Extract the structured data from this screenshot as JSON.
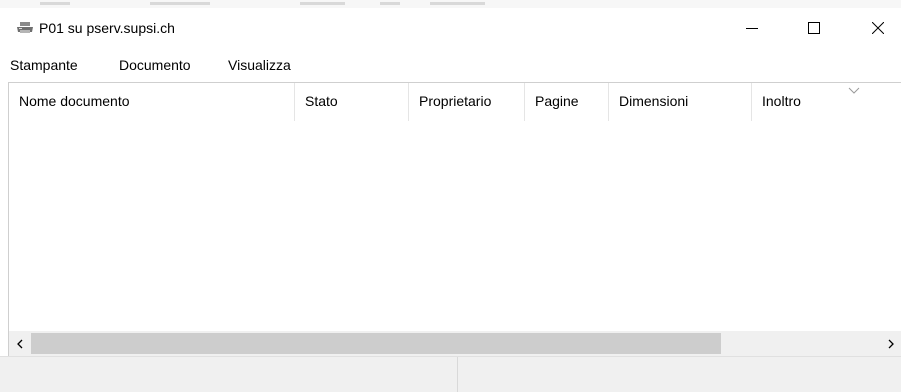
{
  "window": {
    "title": "P01 su pserv.supsi.ch",
    "app_icon": "printer-icon",
    "controls": [
      "minimize-icon",
      "maximize-icon",
      "close-icon"
    ]
  },
  "menubar": {
    "items": [
      {
        "label": "Stampante"
      },
      {
        "label": "Documento"
      },
      {
        "label": "Visualizza"
      }
    ]
  },
  "table": {
    "columns": [
      {
        "label": "Nome documento"
      },
      {
        "label": "Stato"
      },
      {
        "label": "Proprietario"
      },
      {
        "label": "Pagine"
      },
      {
        "label": "Dimensioni"
      },
      {
        "label": "Inoltro"
      }
    ],
    "rows": [],
    "sort_indicator": "chevron-down-icon"
  },
  "scrollbar": {
    "left_arrow": "chevron-left-icon",
    "right_arrow": "chevron-right-icon"
  },
  "statusbar": {
    "panes": [
      "",
      ""
    ]
  }
}
